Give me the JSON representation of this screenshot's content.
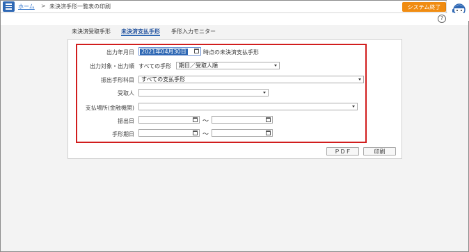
{
  "header": {
    "home": "ホーム",
    "separator": ">",
    "current": "未決済手形一覧表の印刷",
    "exit_label": "システム終了",
    "help": "?"
  },
  "tabs": [
    {
      "label": "未決済受取手形",
      "active": false
    },
    {
      "label": "未決済支払手形",
      "active": true
    },
    {
      "label": "手形入力モニター",
      "active": false
    }
  ],
  "form": {
    "output_date_label": "出力年月日",
    "output_date_value": "2021年04月30日",
    "output_date_suffix": "時点の未決済支払手形",
    "target_label": "出力対象・出力順",
    "target_value": "すべての手形",
    "order_value": "期日／受取人順",
    "account_label": "振出手形科目",
    "account_value": "すべての支払手形",
    "payee_label": "受取人",
    "payee_value": "",
    "bank_label": "支払場所(金融機関)",
    "bank_value": "",
    "issue_date_label": "振出日",
    "due_date_label": "手形期日",
    "range_sep": "〜"
  },
  "buttons": {
    "pdf": "ＰＤＦ",
    "print": "印刷"
  },
  "colors": {
    "accent": "#2f68b4",
    "exit": "#f08c12",
    "highlight_box": "#d11d1d"
  }
}
